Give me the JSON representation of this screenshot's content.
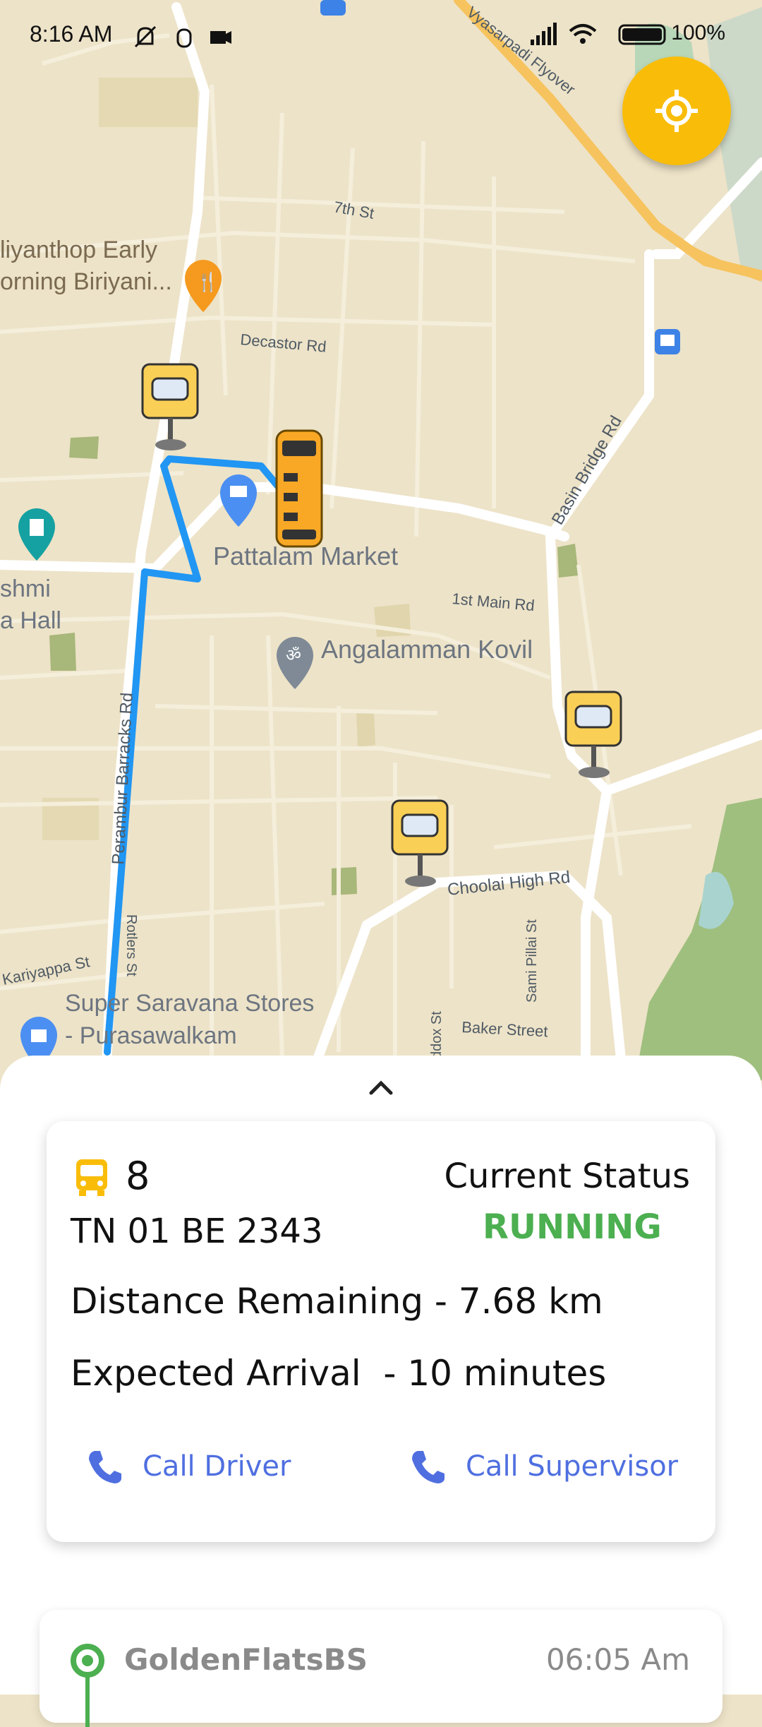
{
  "status_bar": {
    "time": "8:16 AM",
    "battery": "100%",
    "icons": [
      "mute-icon",
      "hand-icon",
      "video-icon",
      "signal-icon",
      "wifi-icon",
      "battery-icon"
    ]
  },
  "map": {
    "labels": {
      "flyover": "Vyasarpadi Flyover",
      "seventh_st": "7th St",
      "biriyani_1": "liyanthop Early",
      "biriyani_2": "orning Biriyani...",
      "decastor": "Decastor Rd",
      "basin_bridge": "Basin Bridge Rd",
      "pattalam": "Pattalam Market",
      "lakshmi_1": "shmi",
      "lakshmi_2": "a Hall",
      "first_main": "1st Main Rd",
      "angalamman": "Angalamman Kovil",
      "perambur": "Perambur Barracks Rd",
      "cholai": "Choolai High Rd",
      "rotlers": "Rotlers St",
      "sami_pillai": "Sami Pillai St",
      "kariyappa": "Kariyappa St",
      "saravana_1": "Super Saravana Stores",
      "saravana_2": "- Purasawalkam",
      "baker": "Baker Street",
      "paddox": "ddox St"
    },
    "icons": [
      "bus-stop-icon",
      "restaurant-pin-icon",
      "shopping-pin-icon",
      "temple-pin-icon",
      "cinema-pin-icon",
      "shopping-bag-pin-icon",
      "transit-icon",
      "school-bus-icon"
    ]
  },
  "locate_button": {
    "icon": "my-location-icon"
  },
  "sheet": {
    "handle_icon": "chevron-up-icon",
    "bus": {
      "route_number": "8",
      "plate": "TN 01 BE 2343",
      "status_label": "Current Status",
      "status_value": "RUNNING",
      "distance": "Distance Remaining - 7.68 km",
      "arrival": "Expected Arrival  - 10 minutes",
      "call_driver": "Call Driver",
      "call_supervisor": "Call Supervisor"
    },
    "stops": [
      {
        "name": "GoldenFlatsBS",
        "time": "06:05 Am"
      }
    ]
  },
  "colors": {
    "accent": "#f9bd09",
    "route": "#2196f3",
    "running": "#4caf50",
    "link": "#4f6fe0"
  }
}
